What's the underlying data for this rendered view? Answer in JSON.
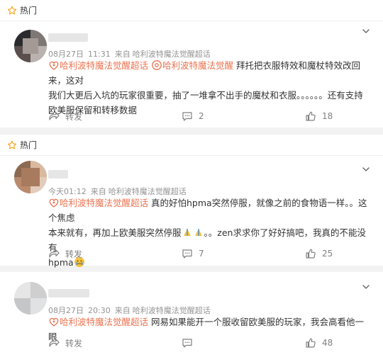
{
  "hot_label": "热门",
  "comments": [
    {
      "date": "08月27日",
      "time": "11:31",
      "source_prefix": "来自",
      "source": "哈利波特魔法觉醒超话",
      "topic1": "哈利波特魔法觉醒超话",
      "topic2": "哈利波特魔法觉醒",
      "text_line1_rest": "拜托把衣服特效和魔杖特效改回来，这对",
      "text_line2": "我们大更后入坑的玩家很重要，抽了一堆拿不出手的魔杖和衣服。。。。。。还有支持",
      "text_line3": "欧美服保留和转移数据",
      "share": "转发",
      "comment_count": "2",
      "like_count": "18"
    },
    {
      "date": "今天",
      "time": "01:12",
      "source_prefix": "来自",
      "source": "哈利波特魔法觉醒超话",
      "topic1": "哈利波特魔法觉醒超话",
      "text_line1_rest": "真的好怕hpma突然停服，就像之前的食物语一样。。这个焦虑",
      "text_line2a": "本来就有，再加上欧美服突然停服",
      "text_line2b": "。。zen求求你了好好搞吧，我真的不能没有",
      "text_line3": "hpma",
      "share": "转发",
      "comment_count": "7",
      "like_count": "25"
    },
    {
      "date": "08月27日",
      "time": "20:30",
      "source_prefix": "来自",
      "source": "哈利波特魔法觉醒超话",
      "topic1": "哈利波特魔法觉醒超话",
      "text_line1_rest": "网易如果能开一个服收留欧美服的玩家，我会高看他一眼",
      "share": "转发",
      "comment_count": "",
      "like_count": "48"
    }
  ],
  "colors": {
    "topic": "#eb7350",
    "meta": "#939393",
    "background": "#f2f2f2"
  }
}
